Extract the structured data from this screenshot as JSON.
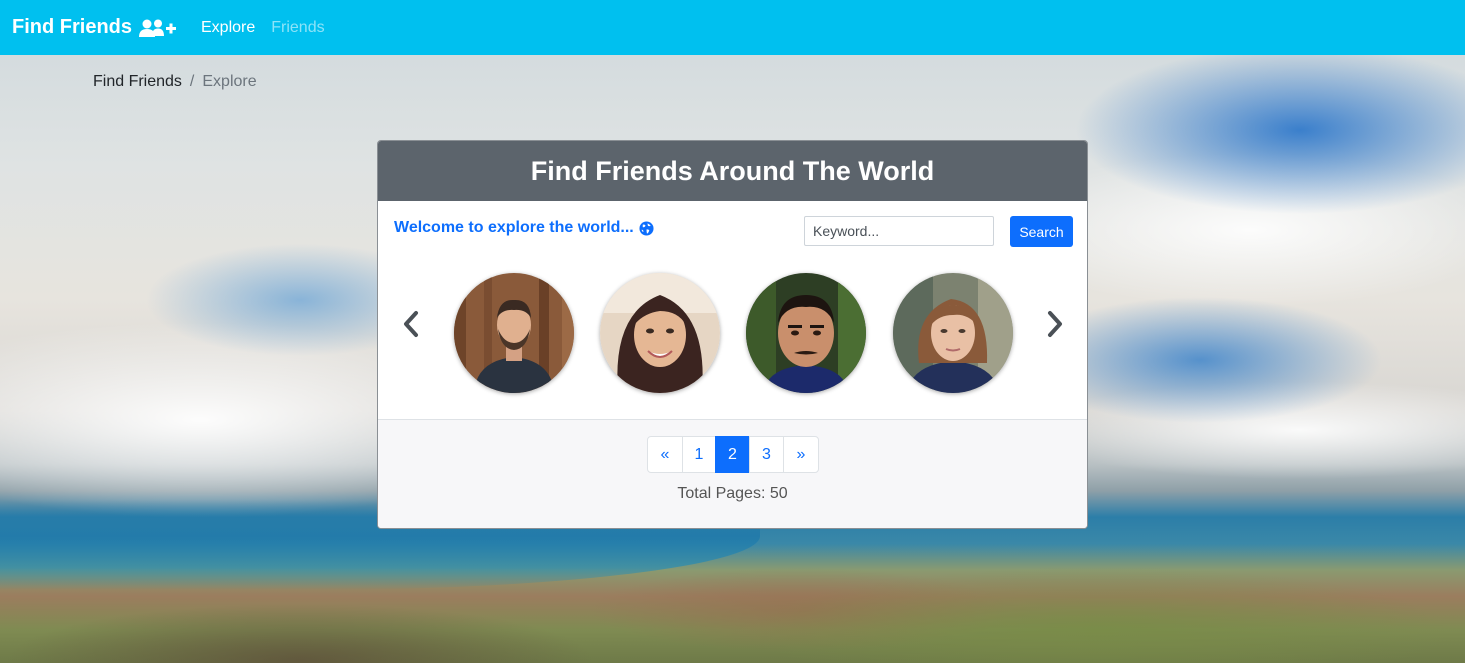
{
  "navbar": {
    "brand": "Find Friends",
    "brand_icon": "user-plus-icon",
    "links": [
      {
        "label": "Explore",
        "active": true
      },
      {
        "label": "Friends",
        "active": false
      }
    ],
    "bg_color": "#00c0ef"
  },
  "breadcrumb": {
    "items": [
      "Find Friends",
      "Explore"
    ]
  },
  "card": {
    "title": "Find Friends Around The World",
    "welcome": "Welcome to explore the world...",
    "welcome_icon": "globe-icon",
    "search": {
      "placeholder": "Keyword...",
      "value": "",
      "button_label": "Search"
    },
    "carousel": {
      "prev_icon": "chevron-left-icon",
      "next_icon": "chevron-right-icon",
      "avatars": [
        {
          "icon": "person-photo-bearded-man"
        },
        {
          "icon": "person-photo-smiling-woman"
        },
        {
          "icon": "person-photo-man-mustache"
        },
        {
          "icon": "person-photo-young-woman"
        }
      ]
    },
    "pagination": {
      "prev": "«",
      "pages": [
        "1",
        "2",
        "3"
      ],
      "active_page": "2",
      "next": "»"
    },
    "total_pages_text": "Total Pages: 50"
  },
  "colors": {
    "primary": "#0d6efd",
    "header": "#5c646c"
  }
}
